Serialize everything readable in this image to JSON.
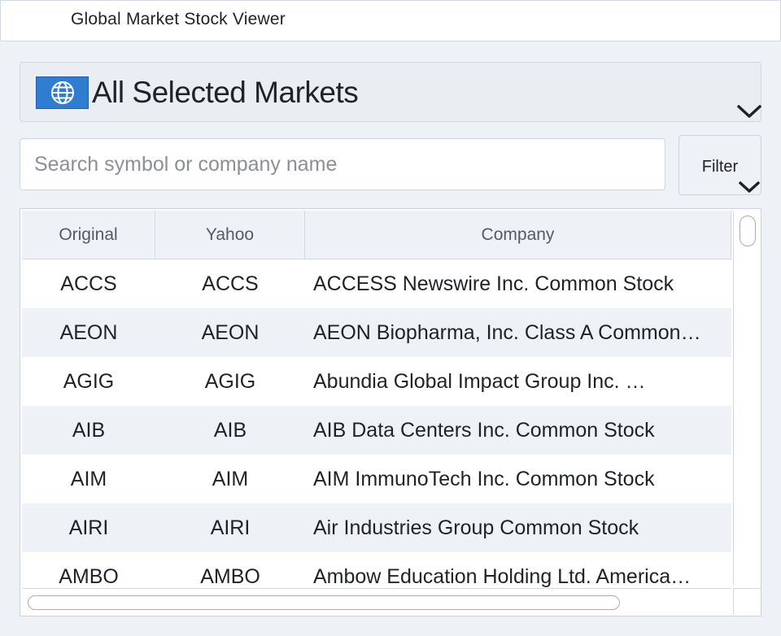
{
  "app": {
    "title": "Global Market Stock Viewer"
  },
  "market_selector": {
    "label": "All Selected Markets",
    "icon": "globe-icon"
  },
  "search": {
    "placeholder": "Search symbol or company name",
    "value": ""
  },
  "filter": {
    "label": "Filter"
  },
  "table": {
    "columns": [
      "Original",
      "Yahoo",
      "Company"
    ],
    "rows": [
      {
        "original": "ACCS",
        "yahoo": "ACCS",
        "company": "ACCESS Newswire Inc. Common Stock"
      },
      {
        "original": "AEON",
        "yahoo": "AEON",
        "company": "AEON Biopharma, Inc. Class A Common…"
      },
      {
        "original": "AGIG",
        "yahoo": "AGIG",
        "company": "Abundia Global Impact Group Inc. …"
      },
      {
        "original": "AIB",
        "yahoo": "AIB",
        "company": "AIB Data Centers Inc. Common Stock"
      },
      {
        "original": "AIM",
        "yahoo": "AIM",
        "company": "AIM ImmunoTech Inc. Common Stock"
      },
      {
        "original": "AIRI",
        "yahoo": "AIRI",
        "company": "Air Industries Group Common Stock"
      },
      {
        "original": "AMBO",
        "yahoo": "AMBO",
        "company": "Ambow Education Holding Ltd. America…"
      }
    ]
  },
  "colors": {
    "accent": "#2f7dd1",
    "row_alt": "#eef1f5",
    "background": "#eef1f5"
  }
}
